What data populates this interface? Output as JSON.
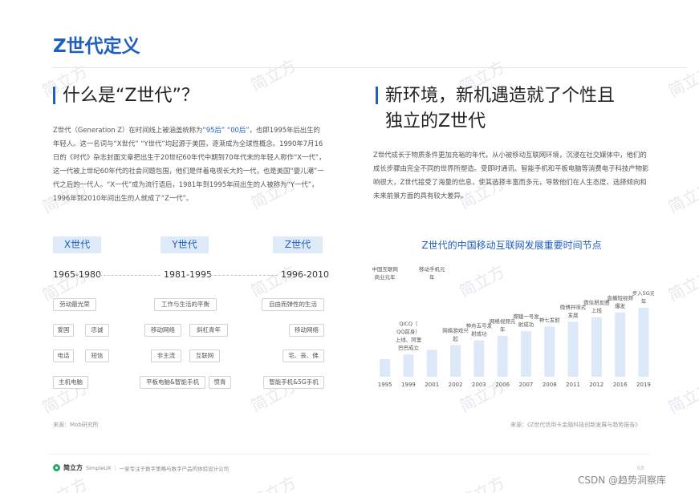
{
  "page_title": "Z世代定义",
  "watermark": "简立方",
  "left": {
    "heading": "什么是“Z世代”？",
    "para_a": "Z世代（Generation Z）在时间线上被涵盖统称为",
    "para_hl": "“95后” “00后”",
    "para_b": "，也即1995年后出生的年轻人。这一名词与“X世代” “Y世代”均起源于美国，逐渐成为全球性概念。1990年7月16日的《时代》杂志封面文章把出生于20世纪60年代中期到70年代末的年轻人称作“X一代”，这一代被上世纪60年代的社会问题包围，他们是伴着电视长大的一代，也是美国“婴儿潮”一代之后的一代人。“X一代”成为流行语后，1981年到1995年间出生的人被称为“Y一代”，1996年到2010年间出生的人就成了“Z一代”。",
    "generations": [
      {
        "name": "X世代",
        "years": "1965-1980",
        "tags": [
          "劳动最光荣",
          "爱国",
          "忠诚",
          "电话",
          "短信",
          "主机电脑"
        ]
      },
      {
        "name": "Y世代",
        "years": "1981-1995",
        "tags": [
          "工作与生活的平衡",
          "移动网络",
          "斜杠青年",
          "非主流",
          "互联网",
          "平板电脑&智能手机",
          "愤青"
        ]
      },
      {
        "name": "Z世代",
        "years": "1996-2010",
        "tags": [
          "自由而弹性的生活",
          "移动网络",
          "宅、丧、佛",
          "智能手机&5G手机"
        ]
      }
    ],
    "source": "来源：Mob研究所"
  },
  "right": {
    "heading_line1": "新环境，新机遇造就了个性且",
    "heading_line2": "独立的Z世代",
    "para": "Z世代成长于物质条件更加充裕的年代，从小被移动互联网环境，沉浸在社交媒体中，他们的成长步骤由完全不同的世界所塑造。受即时通讯、智能手机和平板电脑等消费电子科技产物影响很大，Z世代接受了海量的信息，使其选择丰富而多元，导致他们在人生态度、选择倾向和未来前景方面的具有较大差异。",
    "source": "来源：《Z世代信用卡金融科技创新发展与趋势报告》"
  },
  "chart_data": {
    "type": "bar",
    "title": "Z世代的中国移动互联网发展重要时间节点",
    "categories": [
      "1995",
      "1999",
      "2001",
      "2002",
      "2003",
      "2006",
      "2007",
      "2008",
      "2011",
      "2012",
      "2016",
      "2019"
    ],
    "values": [
      1,
      2,
      3,
      4,
      5,
      6,
      7,
      8,
      9,
      10,
      11,
      12
    ],
    "annotations": [
      "中国互联网商业元年",
      "QICQ（QQ前身）上线、阿里巴巴成立",
      "移动手机元年",
      "网络游戏兴起",
      "神舟五号发射成功",
      "网络视频元年",
      "嫦娥一号发射成功",
      "神七发射",
      "微博井喷式发展",
      "微信朋友圈上线",
      "直播短视频爆发",
      "步入5G元年"
    ],
    "bar_color": "#dde9f8"
  },
  "footer": {
    "brand": "简立方",
    "brand_en": "SimpleUX",
    "tagline": "一家专注于数字策略与数字产品的体验设计公司",
    "page_number": "03"
  },
  "credit": "CSDN @趋势洞察库"
}
